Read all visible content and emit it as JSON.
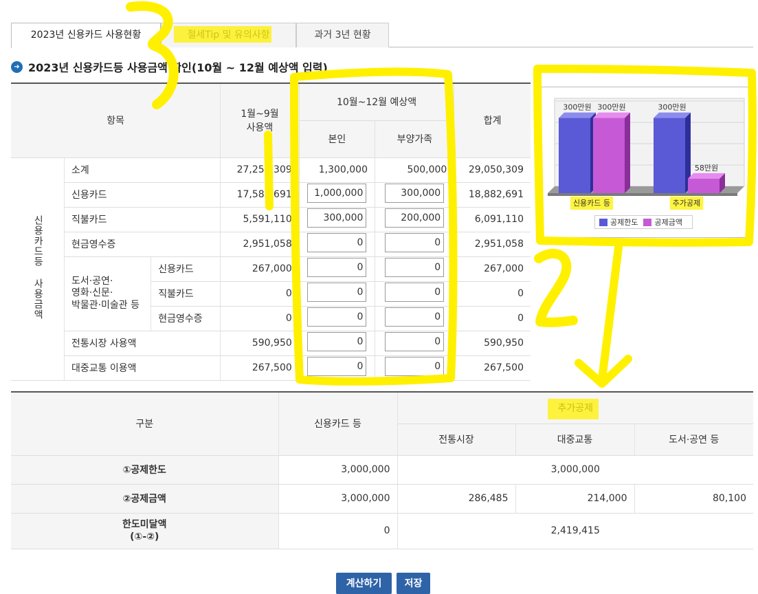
{
  "tabs": [
    {
      "label": "2023년 신용카드 사용현황",
      "active": true
    },
    {
      "label": "절세Tip 및 유의사항",
      "active": false
    },
    {
      "label": "과거 3년 현황",
      "active": false
    }
  ],
  "section_title": "2023년 신용카드등 사용금액 확인(10월 ~ 12월 예상액 입력)",
  "table1": {
    "headers": {
      "item": "항목",
      "jan_sep": "1월~9월\n사용액",
      "oct_dec": "10월~12월 예상액",
      "self": "본인",
      "dependents": "부양가족",
      "total": "합계"
    },
    "group_label": "신용카드등 사용금액",
    "culture_label": "도서·공연·\n영화·신문·\n박물관·미술관 등",
    "rows": [
      {
        "label": "소계",
        "jan_sep": "27,250,309",
        "self": "1,300,000",
        "dep": "500,000",
        "total": "29,050,309"
      },
      {
        "label": "신용카드",
        "jan_sep": "17,582,691",
        "self": "1,000,000",
        "dep": "300,000",
        "total": "18,882,691"
      },
      {
        "label": "직불카드",
        "jan_sep": "5,591,110",
        "self": "300,000",
        "dep": "200,000",
        "total": "6,091,110"
      },
      {
        "label": "현금영수증",
        "jan_sep": "2,951,058",
        "self": "0",
        "dep": "0",
        "total": "2,951,058"
      },
      {
        "label": "신용카드",
        "jan_sep": "267,000",
        "self": "0",
        "dep": "0",
        "total": "267,000"
      },
      {
        "label": "직불카드",
        "jan_sep": "0",
        "self": "0",
        "dep": "0",
        "total": "0"
      },
      {
        "label": "현금영수증",
        "jan_sep": "0",
        "self": "0",
        "dep": "0",
        "total": "0"
      },
      {
        "label": "전통시장 사용액",
        "jan_sep": "590,950",
        "self": "0",
        "dep": "0",
        "total": "590,950"
      },
      {
        "label": "대중교통 이용액",
        "jan_sep": "267,500",
        "self": "0",
        "dep": "0",
        "total": "267,500"
      }
    ]
  },
  "table2": {
    "headers": {
      "category": "구분",
      "credit_etc": "신용카드 등",
      "extra": "추가공제",
      "market": "전통시장",
      "transit": "대중교통",
      "culture": "도서·공연 등"
    },
    "rows": {
      "limit_label": "①공제한도",
      "limit_credit": "3,000,000",
      "limit_extra": "3,000,000",
      "amount_label": "②공제금액",
      "amount_credit": "3,000,000",
      "amount_market": "286,485",
      "amount_transit": "214,000",
      "amount_culture": "80,100",
      "shortfall_label": "한도미달액\n(①-②)",
      "shortfall_credit": "0",
      "shortfall_extra": "2,419,415"
    }
  },
  "buttons": {
    "calculate": "계산하기",
    "save": "저장"
  },
  "annotations": {
    "n1": "1",
    "n2": "2",
    "n3": "3"
  },
  "chart_data": {
    "type": "bar",
    "categories": [
      "신용카드 등",
      "추가공제"
    ],
    "series": [
      {
        "name": "공제한도",
        "values": [
          300,
          300
        ],
        "labels": [
          "300만원",
          "300만원"
        ],
        "color": "#5a5ad6"
      },
      {
        "name": "공제금액",
        "values": [
          300,
          58
        ],
        "labels": [
          "300만원",
          "58만원"
        ],
        "color": "#c65ad6"
      }
    ],
    "unit": "만원",
    "ylim": [
      0,
      340
    ],
    "grid": true,
    "legend_position": "bottom"
  },
  "colors": {
    "accent": "#2f63a8",
    "highlight": "#fff000",
    "bar1": "#5a5ad6",
    "bar2": "#c65ad6"
  }
}
